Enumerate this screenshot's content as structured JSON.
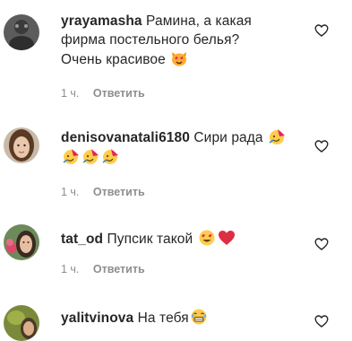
{
  "comments": [
    {
      "username": "yrayamasha",
      "text": "Рамина, а какая фирма постельного белья? Очень красивое",
      "text_line1": "Рамина, а какая",
      "text_line2": "фирма постельного белья?",
      "text_line3": "Очень красивое",
      "emojis": [
        "heart-eyes-cat-emoji"
      ],
      "time": "1 ч.",
      "reply_label": "Ответить"
    },
    {
      "username": "denisovanatali6180",
      "text": "Сири рада",
      "emojis": [
        "party-face-emoji",
        "party-face-emoji",
        "party-face-emoji",
        "party-face-emoji"
      ],
      "time": "1 ч.",
      "reply_label": "Ответить"
    },
    {
      "username": "tat_od",
      "text": "Пупсик такой",
      "emojis": [
        "heart-eyes-emoji",
        "red-heart-emoji"
      ],
      "time": "1 ч.",
      "reply_label": "Ответить"
    },
    {
      "username": "yalitvinova",
      "text": "На тебя",
      "emojis": [
        "grimace-laugh-emoji"
      ],
      "time": "",
      "reply_label": ""
    }
  ],
  "colors": {
    "text": "#262626",
    "secondary": "#8e8e8e",
    "heart_outline": "#262626",
    "emoji_red": "#e0245e",
    "emoji_yellow": "#ffcc4d"
  }
}
